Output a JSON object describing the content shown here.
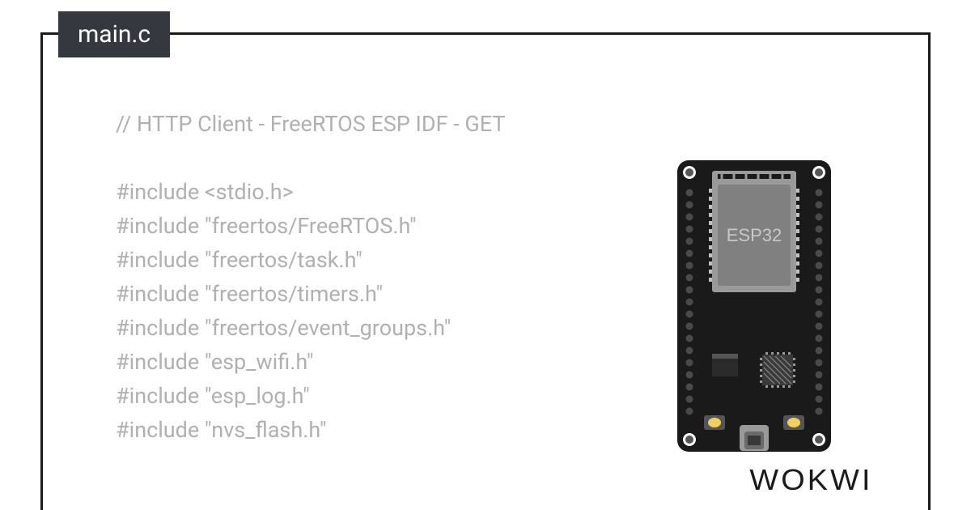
{
  "tab": {
    "filename": "main.c"
  },
  "code": {
    "lines": [
      "// HTTP Client - FreeRTOS ESP IDF - GET",
      "",
      "#include <stdio.h>",
      "#include \"freertos/FreeRTOS.h\"",
      "#include \"freertos/task.h\"",
      "#include \"freertos/timers.h\"",
      "#include \"freertos/event_groups.h\"",
      "#include \"esp_wifi.h\"",
      "#include \"esp_log.h\"",
      "#include \"nvs_flash.h\""
    ]
  },
  "board": {
    "chip_label": "ESP32"
  },
  "brand": "WOKWI"
}
